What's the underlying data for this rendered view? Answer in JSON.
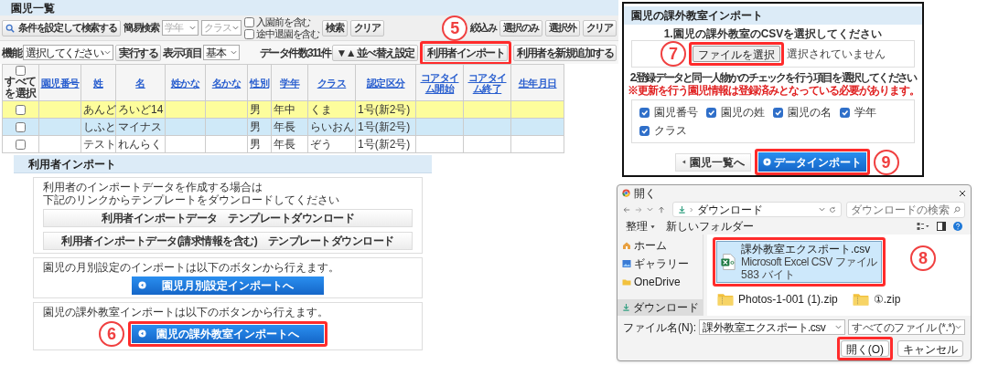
{
  "list_screen": {
    "title": "園児一覧",
    "toolbar": [
      {
        "kind": "search_button",
        "label": "条件を設定して検索する"
      },
      {
        "kind": "label",
        "label": "簡易検索"
      },
      {
        "kind": "select",
        "placeholder": "学年"
      },
      {
        "kind": "select",
        "placeholder": "クラス"
      },
      {
        "kind": "checkboxes",
        "items": [
          {
            "label": "入園前を含む",
            "checked": false
          },
          {
            "label": "途中退園を含む",
            "checked": false
          }
        ]
      },
      {
        "kind": "button",
        "label": "検索",
        "highlighted": false
      },
      {
        "kind": "button",
        "label": "クリア",
        "highlighted": false
      },
      {
        "kind": "step",
        "label": "5"
      },
      {
        "kind": "label",
        "label": "絞込み"
      },
      {
        "kind": "button",
        "label": "選択のみ",
        "highlighted": false
      },
      {
        "kind": "button",
        "label": "選択外",
        "highlighted": false
      },
      {
        "kind": "button",
        "label": "クリア",
        "highlighted": false
      }
    ],
    "function_bar": [
      {
        "kind": "label",
        "label": "機能"
      },
      {
        "kind": "select",
        "value": "選択してください"
      },
      {
        "kind": "button",
        "label": "実行する",
        "highlighted": false
      },
      {
        "kind": "label",
        "label": "表示項目"
      },
      {
        "kind": "select",
        "value": "基本"
      },
      {
        "kind": "count",
        "label": "データ件数311件"
      },
      {
        "kind": "button",
        "label": "▼▲ 並べ替え設定",
        "highlighted": false
      },
      {
        "kind": "button",
        "label": "利用者インポート",
        "highlighted": true
      },
      {
        "kind": "button",
        "label": "利用者を新規追加する",
        "highlighted": false
      }
    ],
    "table": {
      "select_all": {
        "label": "すべてを選択",
        "checked": false
      },
      "columns": [
        "園児番号",
        "姓",
        "名",
        "姓かな",
        "名かな",
        "性別",
        "学年",
        "クラス",
        "認定区分",
        "コアタイム開始",
        "コアタイム終了",
        "生年月日"
      ],
      "rows": [
        {
          "color": "#fdfd9c",
          "checked": false,
          "cells": [
            "",
            "あんど",
            "ろいど14",
            "",
            "",
            "男",
            "年中",
            "くま",
            "1号(新2号)",
            "",
            "",
            ""
          ]
        },
        {
          "color": "#cfe9f8",
          "checked": false,
          "cells": [
            "",
            "しふと",
            "マイナス",
            "",
            "",
            "男",
            "年長",
            "らいおん",
            "1号(新2号)",
            "",
            "",
            ""
          ]
        },
        {
          "color": "#ffffff",
          "checked": false,
          "cells": [
            "",
            "テスト",
            "れんらく",
            "",
            "",
            "男",
            "年長",
            "ぞう",
            "1号(新2号)",
            "",
            "",
            ""
          ]
        }
      ]
    }
  },
  "user_import": {
    "title": "利用者インポート",
    "sections": [
      {
        "lines": [
          "利用者のインポートデータを作成する場合は",
          "下記のリンクからテンプレートをダウンロードしてください"
        ],
        "buttons": [
          {
            "kind": "template",
            "label": "利用者インポートデータ　テンプレートダウンロード",
            "highlighted": false
          },
          {
            "kind": "template",
            "label": "利用者インポートデータ(請求情報を含む)　テンプレートダウンロード",
            "highlighted": false
          }
        ]
      },
      {
        "lines": [
          "園児の月別設定のインポートは以下のボタンから行えます。"
        ],
        "buttons": [
          {
            "kind": "nav",
            "label": "園児月別設定インポートへ",
            "highlighted": false
          }
        ]
      },
      {
        "lines": [
          "園児の課外教室インポートは以下のボタンから行えます。"
        ],
        "buttons": [
          {
            "kind": "nav",
            "label": "園児の課外教室インポートへ",
            "highlighted": true,
            "step": "6"
          }
        ]
      }
    ]
  },
  "class_import": {
    "title": "園児の課外教室インポート",
    "file_prompt": "1.園児の課外教室のCSVを選択してください",
    "file_button": {
      "label": "ファイルを選択",
      "highlighted": true,
      "step": "7"
    },
    "file_status": "選択されていません",
    "match_prompt": "2.登録データと同一人物かのチェックを行う項目を選択してください",
    "match_note": "※更新を行う園児情報は登録済みとなっている必要があります。",
    "match_options": [
      {
        "label": "園児番号",
        "checked": true
      },
      {
        "label": "園児の姓",
        "checked": true
      },
      {
        "label": "園児の名",
        "checked": true
      },
      {
        "label": "学年",
        "checked": true
      },
      {
        "label": "クラス",
        "checked": true
      }
    ],
    "buttons": [
      {
        "kind": "back",
        "label": "園児一覧へ",
        "highlighted": false
      },
      {
        "kind": "import",
        "label": "データインポート",
        "highlighted": true,
        "step": "9"
      }
    ]
  },
  "open_dialog": {
    "title": "開く",
    "path": "ダウンロード",
    "search_placeholder": "ダウンロードの検索",
    "commands": [
      "整理",
      "新しいフォルダー"
    ],
    "nav": [
      {
        "kind": "home",
        "label": "ホーム",
        "selected": false
      },
      {
        "kind": "gallery",
        "label": "ギャラリー",
        "selected": false
      },
      {
        "kind": "cloud",
        "label": "OneDrive",
        "selected": false
      },
      {
        "kind": "download",
        "label": "ダウンロード",
        "selected": true
      }
    ],
    "files": [
      {
        "kind": "csv",
        "name": "課外教室エクスポート.csv",
        "type": "Microsoft Excel CSV ファイル",
        "size": "583 バイト",
        "selected": true,
        "highlighted": true
      },
      {
        "kind": "zip",
        "name": "Photos-1-001 (1).zip",
        "selected": false,
        "highlighted": false
      },
      {
        "kind": "zip",
        "name": "①.zip",
        "selected": false,
        "highlighted": false
      }
    ],
    "step": "8",
    "filename_label": "ファイル名(N):",
    "filename": "課外教室エクスポート.csv",
    "filter": "すべてのファイル (*.*)",
    "buttons": [
      {
        "label": "開く(O)",
        "highlighted": true
      },
      {
        "label": "キャンセル",
        "highlighted": false
      }
    ]
  }
}
